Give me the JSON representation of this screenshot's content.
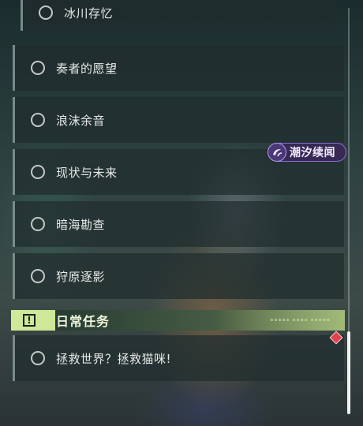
{
  "quests": [
    {
      "label": "冰川存忆"
    },
    {
      "label": "奏者的愿望"
    },
    {
      "label": "浪沫余音"
    },
    {
      "label": "现状与未来"
    },
    {
      "label": "暗海勘查"
    },
    {
      "label": "狩原逐影"
    }
  ],
  "badge": {
    "label": "潮汐续闻",
    "icon": "tide-swirl-icon",
    "color": "#8b6fd6"
  },
  "daily_section": {
    "title": "日常任务",
    "icon": "exclamation-box-icon",
    "accent": "#c6e38b",
    "items": [
      {
        "label": "拯救世界？拯救猫咪!",
        "marker": "diamond-icon",
        "marker_color": "#e0434f"
      }
    ]
  }
}
